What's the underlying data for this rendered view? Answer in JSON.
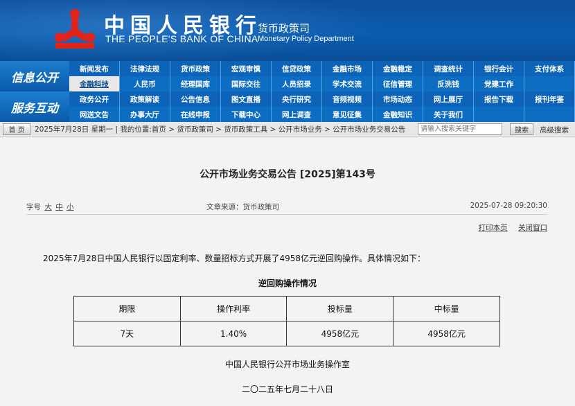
{
  "header": {
    "bank_name_cn": "中国人民银行",
    "bank_name_en": "THE PEOPLE'S BANK OF CHINA",
    "dept_cn": "货币政策司",
    "dept_en": "Monetary Policy Department",
    "logo_icon": "pboc-emblem-icon",
    "brand_color": "#0b55a5",
    "logo_color": "#e2231a"
  },
  "nav": {
    "block1": "信息公开",
    "block2": "服务互动",
    "row1": [
      "新闻发布",
      "法律法规",
      "货币政策",
      "宏观审慎",
      "信贷政策",
      "金融市场",
      "金融稳定",
      "调查统计",
      "银行会计",
      "支付体系"
    ],
    "row2": [
      "金融科技",
      "人民币",
      "经理国库",
      "国际交往",
      "人员招录",
      "学术交流",
      "征信管理",
      "反洗钱",
      "党建工作",
      ""
    ],
    "row3": [
      "政务公开",
      "政策解读",
      "公告信息",
      "图文直播",
      "央行研究",
      "音频视频",
      "市场动态",
      "网上展厅",
      "报告下载",
      "报刊年鉴"
    ],
    "row4": [
      "网送文告",
      "办事大厅",
      "在线申报",
      "下载中心",
      "网上调查",
      "意见征集",
      "金融知识",
      "关于我们",
      "",
      ""
    ]
  },
  "breadcrumb": {
    "home_label": "首 页",
    "text": "2025年7月28日 星期一 | 我的位置:首页 > 货币政策司 > 货币政策工具 > 公开市场业务 > 公开市场业务交易公告",
    "search_placeholder": "请输入搜索关键字",
    "search_button": "搜索",
    "advanced_search": "高级搜索"
  },
  "article": {
    "title": "公开市场业务交易公告 [2025]第143号",
    "font_size_label": "字号",
    "size_large": "大",
    "size_medium": "中",
    "size_small": "小",
    "source": "文章来源：货币政策司",
    "date": "2025-07-28 09:20:30",
    "print": "打印本页",
    "close": "关闭窗口",
    "paragraph": "2025年7月28日中国人民银行以固定利率、数量招标方式开展了4958亿元逆回购操作。具体情况如下：",
    "table_caption": "逆回购操作情况",
    "table_headers": [
      "期限",
      "操作利率",
      "投标量",
      "中标量"
    ],
    "table_rows": [
      [
        "7天",
        "1.40%",
        "4958亿元",
        "4958亿元"
      ]
    ],
    "signature": "中国人民银行公开市场业务操作室",
    "sign_date": "二〇二五年七月二十八日"
  }
}
